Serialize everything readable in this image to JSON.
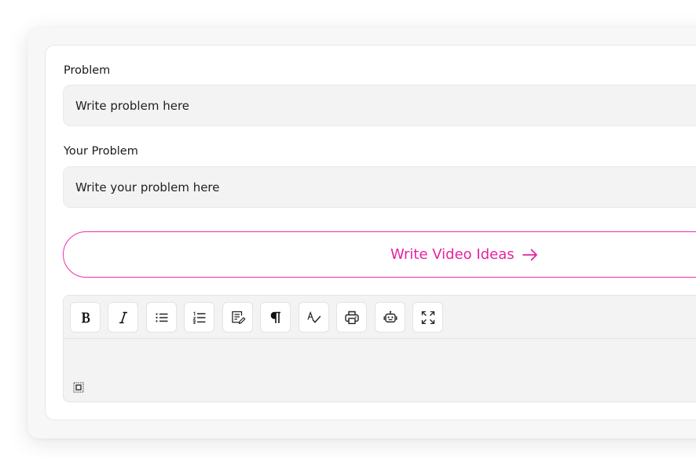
{
  "form": {
    "problem_label": "Problem",
    "problem_placeholder": "Write problem here",
    "your_problem_label": "Your Problem",
    "your_problem_placeholder": "Write your problem here",
    "submit_label": "Write Video Ideas"
  },
  "editor": {
    "toolbar": [
      "bold-icon",
      "italic-icon",
      "bulleted-list-icon",
      "numbered-list-icon",
      "edit-document-icon",
      "paragraph-icon",
      "spell-check-icon",
      "print-icon",
      "ai-robot-icon",
      "fullscreen-icon"
    ]
  },
  "colors": {
    "accent": "#e5239f",
    "input_bg": "#f3f3f3"
  }
}
